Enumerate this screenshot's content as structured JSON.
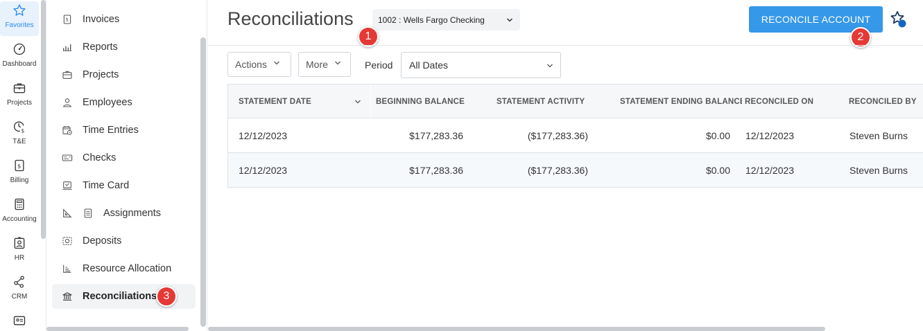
{
  "rail": {
    "items": [
      {
        "label": "Favorites",
        "icon": "star-icon"
      },
      {
        "label": "Dashboard",
        "icon": "gauge-icon"
      },
      {
        "label": "Projects",
        "icon": "briefcase-icon"
      },
      {
        "label": "T&E",
        "icon": "clock-dollar-icon"
      },
      {
        "label": "Billing",
        "icon": "invoice-dollar-icon"
      },
      {
        "label": "Accounting",
        "icon": "calculator-icon"
      },
      {
        "label": "HR",
        "icon": "person-badge-icon"
      },
      {
        "label": "CRM",
        "icon": "network-icon"
      },
      {
        "label": "",
        "icon": "id-card-icon"
      }
    ]
  },
  "submenu": {
    "items": [
      {
        "label": "Invoices",
        "icon": "invoice-icon"
      },
      {
        "label": "Reports",
        "icon": "chart-icon"
      },
      {
        "label": "Projects",
        "icon": "briefcase-icon"
      },
      {
        "label": "Employees",
        "icon": "person-icon"
      },
      {
        "label": "Time Entries",
        "icon": "calendar-clock-icon"
      },
      {
        "label": "Checks",
        "icon": "check-icon"
      },
      {
        "label": "Time Card",
        "icon": "timecard-icon"
      },
      {
        "label": "Assignments",
        "icon": "assignments-icon"
      },
      {
        "label": "Deposits",
        "icon": "deposit-icon"
      },
      {
        "label": "Resource Allocation",
        "icon": "resource-chart-icon"
      },
      {
        "label": "Reconciliations",
        "icon": "bank-icon"
      }
    ]
  },
  "header": {
    "title": "Reconciliations",
    "account": "1002 : Wells Fargo Checking",
    "reconcile_label": "RECONCILE ACCOUNT"
  },
  "badges": {
    "one": "1",
    "two": "2",
    "three": "3"
  },
  "toolbar": {
    "actions_label": "Actions",
    "more_label": "More",
    "period_label": "Period",
    "period_value": "All Dates"
  },
  "table": {
    "columns": [
      "STATEMENT DATE",
      "BEGINNING BALANCE",
      "STATEMENT ACTIVITY",
      "STATEMENT ENDING BALANCE",
      "RECONCILED ON",
      "RECONCILED BY"
    ],
    "rows": [
      [
        "12/12/2023",
        "$177,283.36",
        "($177,283.36)",
        "$0.00",
        "12/12/2023",
        "Steven Burns"
      ],
      [
        "12/12/2023",
        "$177,283.36",
        "($177,283.36)",
        "$0.00",
        "12/12/2023",
        "Steven Burns"
      ]
    ]
  },
  "colors": {
    "accent": "#3598e8",
    "badge": "#e53935"
  }
}
